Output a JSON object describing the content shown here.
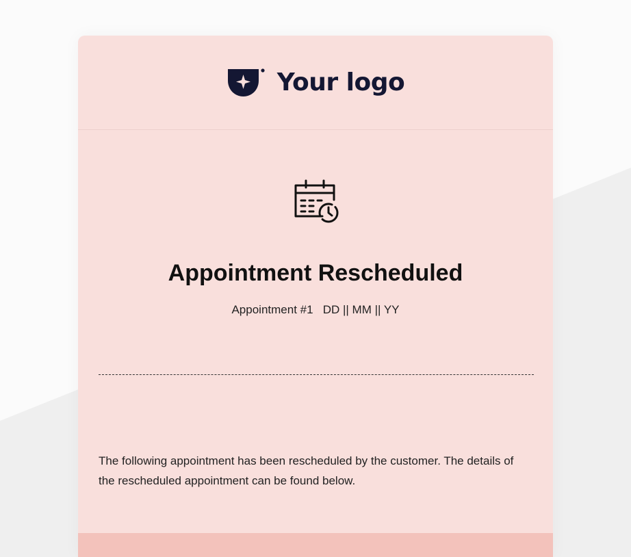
{
  "logo": {
    "icon": "shield-star-logo-icon",
    "text": "Your logo"
  },
  "hero": {
    "icon": "calendar-clock-icon",
    "title": "Appointment Rescheduled",
    "subtitle": "Appointment #1   DD || MM || YY"
  },
  "message": {
    "text": "The following appointment has been rescheduled by the customer. The details of the rescheduled appointment can be found below."
  },
  "colors": {
    "card_background": "#f9dfdc",
    "footer_band": "#f3c2bb",
    "logo_navy": "#141733",
    "page_background": "#f6f6f6"
  }
}
